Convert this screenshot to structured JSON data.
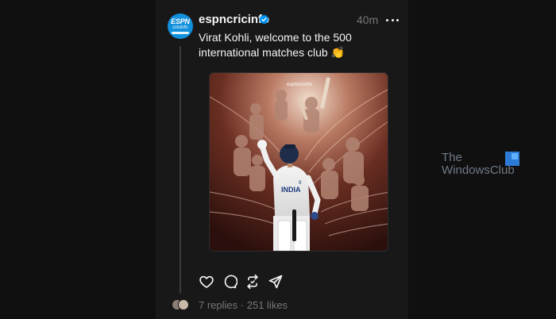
{
  "post": {
    "username": "espncricinfo",
    "avatar_text_top": "ESPN",
    "avatar_text_bottom": "cricinfo",
    "time": "40m",
    "text": "Virat Kohli, welcome to the 500 international matches club 👏",
    "image": {
      "watermark": "espncricinfo",
      "jersey_text": "INDIA",
      "jersey_number": "9"
    }
  },
  "actions": [
    "heart-icon",
    "comment-icon",
    "repost-icon",
    "share-icon"
  ],
  "stats": {
    "replies": "7 replies",
    "separator": "·",
    "likes": "251 likes"
  },
  "watermark": {
    "line1": "The",
    "line2": "WindowsClub"
  },
  "colors": {
    "background": "#101010",
    "panel": "#181818",
    "text": "#f3f5f7",
    "muted": "#777777",
    "verified": "#0095f6",
    "avatar": "#1190dc"
  }
}
